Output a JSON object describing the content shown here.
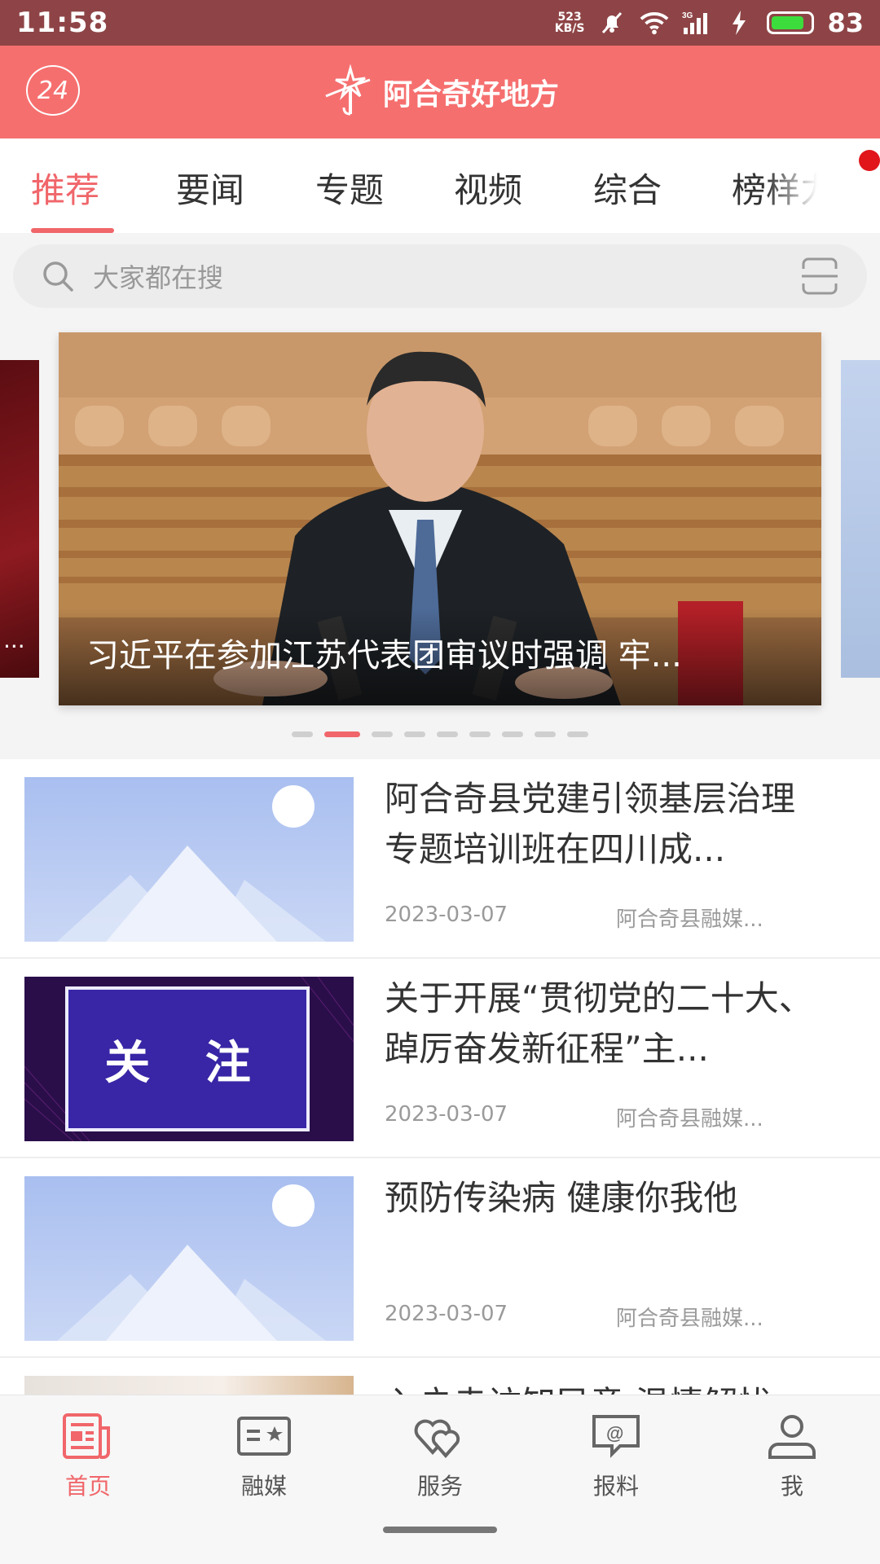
{
  "status_bar": {
    "time": "11:58",
    "net_speed_value": "523",
    "net_speed_unit": "KB/S",
    "network_type": "3G",
    "battery_level": "83",
    "battery_fraction": 0.83
  },
  "header": {
    "badge_24": "24",
    "title": "阿合奇好地方"
  },
  "tabs": [
    {
      "label": "推荐",
      "active": true
    },
    {
      "label": "要闻"
    },
    {
      "label": "专题"
    },
    {
      "label": "视频"
    },
    {
      "label": "综合"
    },
    {
      "label": "榜样力量"
    }
  ],
  "search": {
    "placeholder": "大家都在搜"
  },
  "carousel": {
    "side_left_text": "...",
    "caption": "习近平在参加江苏代表团审议时强调 牢...",
    "dot_count": 9,
    "active_index": 1
  },
  "news": [
    {
      "title": "阿合奇县党建引领基层治理专题培训班在四川成...",
      "date": "2023-03-07",
      "source": "阿合奇县融媒..."
    },
    {
      "title": "关于开展“贯彻党的二十大、踔厉奋发新征程”主...",
      "date": "2023-03-07",
      "source": "阿合奇县融媒...",
      "thumb_text": "关 注"
    },
    {
      "title": "预防传染病 健康你我他",
      "date": "2023-03-07",
      "source": "阿合奇县融媒..."
    },
    {
      "title": "入户走访知民意 温情解忧"
    }
  ],
  "bottom_nav": [
    {
      "label": "首页",
      "icon": "home-news-icon",
      "active": true
    },
    {
      "label": "融媒",
      "icon": "media-card-icon"
    },
    {
      "label": "服务",
      "icon": "service-hearts-icon"
    },
    {
      "label": "报料",
      "icon": "report-message-icon"
    },
    {
      "label": "我",
      "icon": "profile-icon"
    }
  ],
  "colors": {
    "status_bar": "#8e4446",
    "header": "#f66f6f",
    "accent": "#f0666a"
  }
}
